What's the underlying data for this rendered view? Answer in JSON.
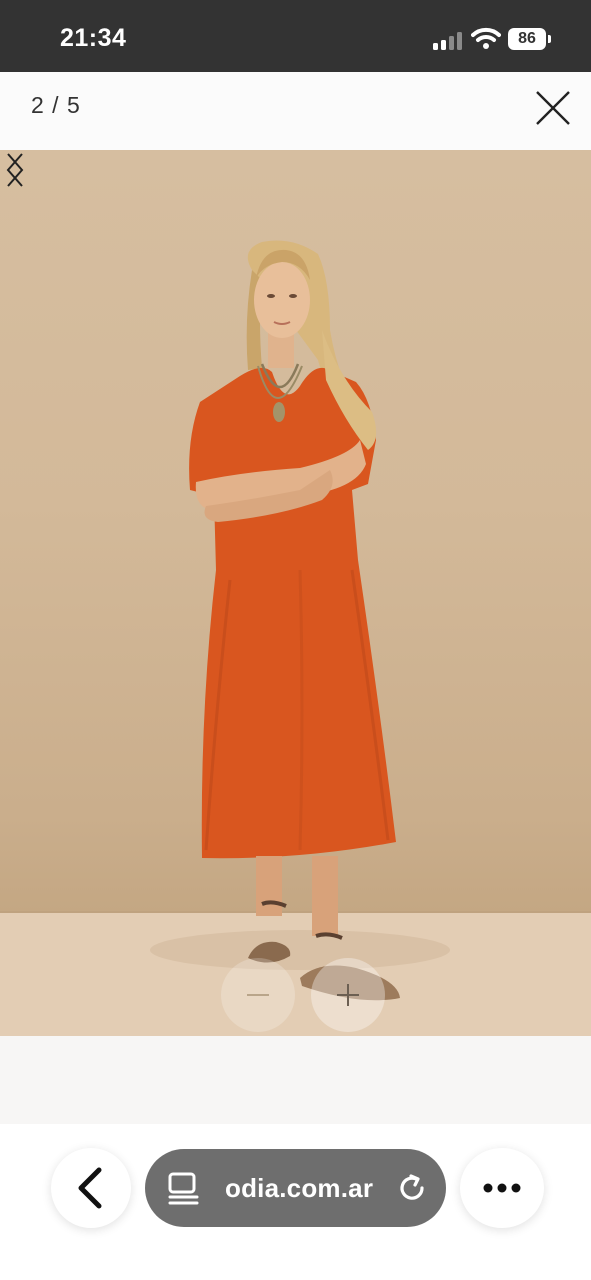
{
  "status_bar": {
    "time": "21:34",
    "battery_level": "86",
    "signal_bars_active": 2,
    "signal_bars_total": 4
  },
  "gallery": {
    "counter": "2 / 5",
    "image_alt": "",
    "icons": {
      "close": "close-icon",
      "previous": "chevron-left-icon",
      "next": "chevron-right-icon",
      "zoom_out": "minus-icon",
      "zoom_in": "plus-icon"
    }
  },
  "browser": {
    "url": "odia.com.ar",
    "icons": {
      "back": "chevron-left-icon",
      "reader": "reader-icon",
      "reload": "reload-icon",
      "more": "more-dots-icon"
    }
  },
  "colors": {
    "status_bar_bg": "#333333",
    "url_pill_bg": "#6e6e6e",
    "dress": "#d9561f",
    "backdrop": "#d4bb9b"
  }
}
